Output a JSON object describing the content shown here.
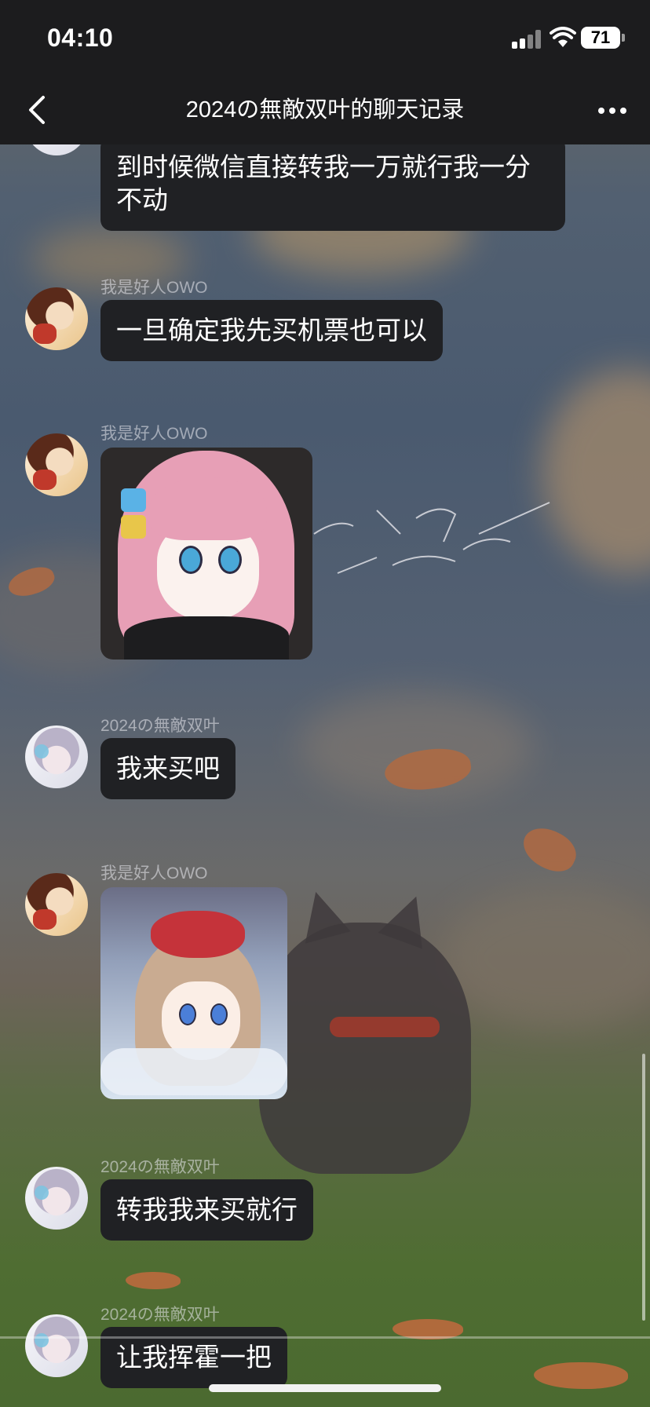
{
  "status_bar": {
    "time": "04:10",
    "battery_level": "71",
    "signal_icon": "cellular-signal-icon",
    "wifi_icon": "wifi-icon"
  },
  "nav": {
    "title": "2024の無敵双叶的聊天记录",
    "back_icon": "chevron-left-icon",
    "more_icon": "more-horizontal-icon"
  },
  "messages": [
    {
      "sender": "",
      "avatar": "avatar-wohaoren",
      "type": "text",
      "text": "到时候微信直接转我一万就行我一分不动"
    },
    {
      "sender": "我是好人OWO",
      "avatar": "avatar-wohaoren",
      "type": "text",
      "text": "一旦确定我先买机票也可以"
    },
    {
      "sender": "我是好人OWO",
      "avatar": "avatar-wohaoren",
      "type": "sticker",
      "sticker": "pink-hair-girl-sticker"
    },
    {
      "sender": "2024の無敵双叶",
      "avatar": "avatar-shuangye",
      "type": "text",
      "text": "我来买吧"
    },
    {
      "sender": "我是好人OWO",
      "avatar": "avatar-wohaoren",
      "type": "sticker",
      "sticker": "bow-girl-sticker"
    },
    {
      "sender": "2024の無敵双叶",
      "avatar": "avatar-shuangye",
      "type": "text",
      "text": "转我我来买就行"
    },
    {
      "sender": "2024の無敵双叶",
      "avatar": "avatar-shuangye",
      "type": "text",
      "text": "让我挥霍一把"
    }
  ],
  "colors": {
    "bar_background": "#1c1c1e",
    "bubble_background": "#202124",
    "bubble_text": "#ffffff",
    "sender_text": "#9a9aa0"
  }
}
